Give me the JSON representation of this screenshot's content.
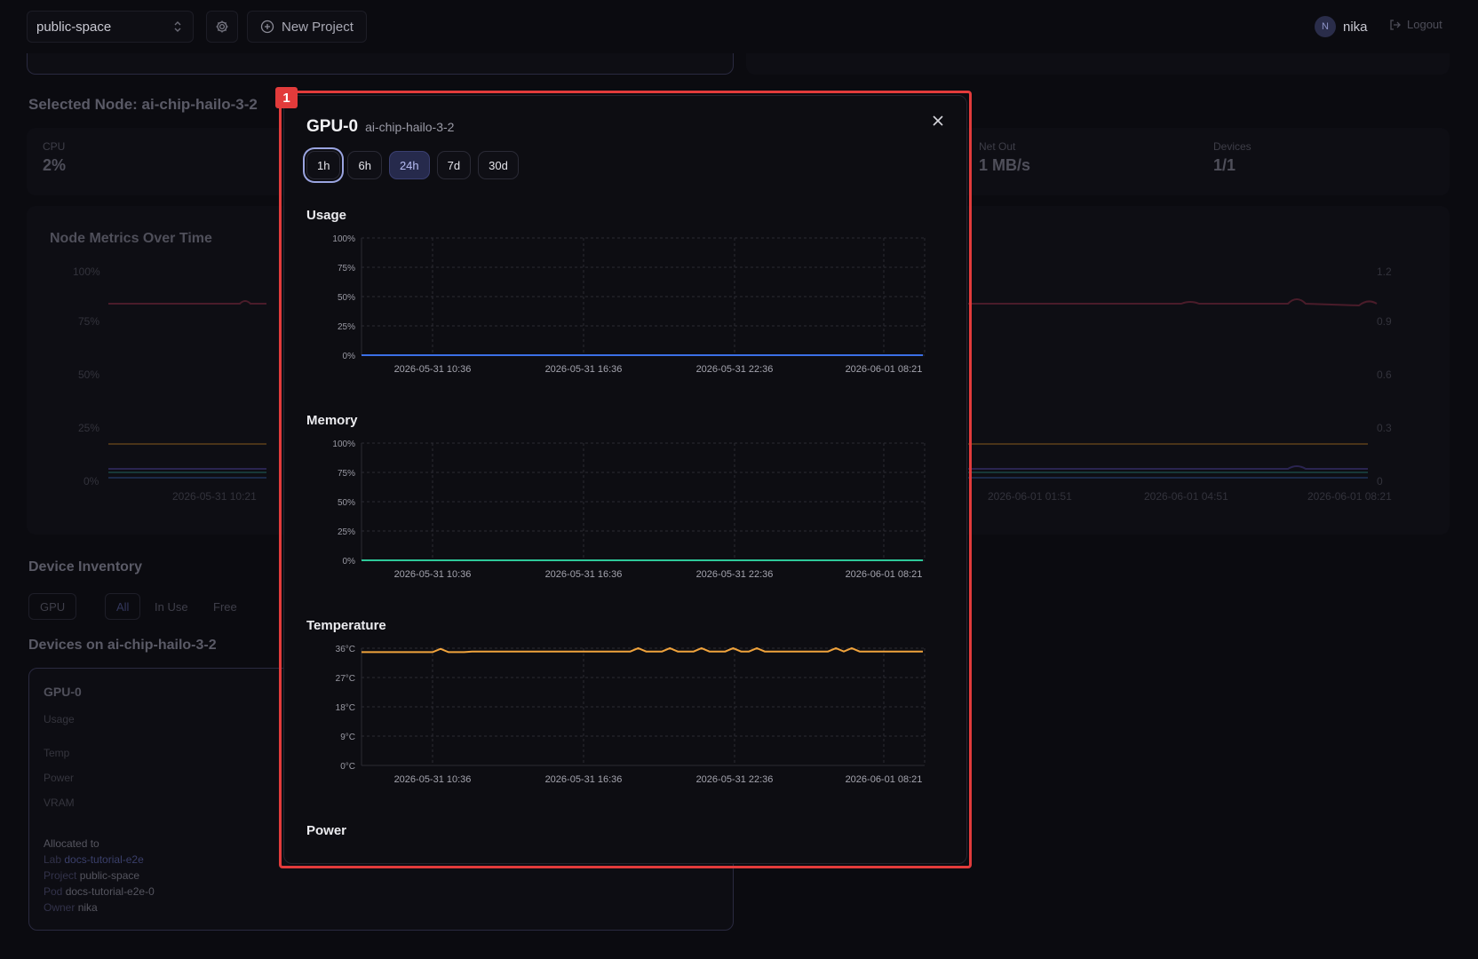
{
  "topbar": {
    "workspace": "public-space",
    "new_project": "New Project",
    "user_initial": "N",
    "user_name": "nika",
    "logout": "Logout"
  },
  "background": {
    "selected_node_title": "Selected Node: ai-chip-hailo-3-2",
    "stats": [
      {
        "label": "CPU",
        "value": "2%"
      },
      {
        "label": "Net Out",
        "value": "1 MB/s"
      },
      {
        "label": "Devices",
        "value": "1/1"
      }
    ],
    "metrics_title": "Node Metrics Over Time",
    "metrics_left_ticks": [
      "100%",
      "75%",
      "50%",
      "25%",
      "0%"
    ],
    "metrics_right_ticks": [
      "1.2",
      "0.9",
      "0.6",
      "0.3",
      "0"
    ],
    "metrics_x_ticks": [
      "2026-05-31 10:21",
      "2026-06-01 01:51",
      "2026-06-01 04:51",
      "2026-06-01 08:21"
    ],
    "inventory_title": "Device Inventory",
    "filters": [
      "GPU",
      "All",
      "In Use",
      "Free"
    ],
    "devices_title": "Devices on ai-chip-hailo-3-2",
    "device_card": {
      "name": "GPU-0",
      "rows": [
        "Usage",
        "Temp",
        "Power",
        "VRAM"
      ],
      "allocated_to": "Allocated to",
      "lab_key": "Lab",
      "lab_val": "docs-tutorial-e2e",
      "project_key": "Project",
      "project_val": "public-space",
      "pod_key": "Pod",
      "pod_val": "docs-tutorial-e2e-0",
      "owner_key": "Owner",
      "owner_val": "nika"
    }
  },
  "modal": {
    "title": "GPU-0",
    "subtitle": "ai-chip-hailo-3-2",
    "ranges": [
      "1h",
      "6h",
      "24h",
      "7d",
      "30d"
    ],
    "active_range": "24h",
    "focused_range": "1h",
    "sections": {
      "usage": "Usage",
      "memory": "Memory",
      "temperature": "Temperature",
      "power": "Power"
    },
    "highlight_badge": "1"
  },
  "colors": {
    "usage_line": "#3b6fe6",
    "memory_line": "#2ec99a",
    "temp_line": "#f0a33c",
    "highlight": "#e23b3b"
  },
  "chart_data": [
    {
      "type": "line",
      "title": "Usage",
      "x_ticks": [
        "2026-05-31 10:36",
        "2026-05-31 16:36",
        "2026-05-31 22:36",
        "2026-06-01 08:21"
      ],
      "y_ticks": [
        "100%",
        "75%",
        "50%",
        "25%",
        "0%"
      ],
      "ylim": [
        0,
        100
      ],
      "values": [
        0,
        0,
        0,
        0,
        0,
        0,
        0,
        0,
        0,
        0,
        0,
        0,
        0,
        0,
        0,
        0,
        0,
        0,
        0,
        0,
        0,
        0,
        0,
        0
      ]
    },
    {
      "type": "line",
      "title": "Memory",
      "x_ticks": [
        "2026-05-31 10:36",
        "2026-05-31 16:36",
        "2026-05-31 22:36",
        "2026-06-01 08:21"
      ],
      "y_ticks": [
        "100%",
        "75%",
        "50%",
        "25%",
        "0%"
      ],
      "ylim": [
        0,
        100
      ],
      "values": [
        0,
        0,
        0,
        0,
        0,
        0,
        0,
        0,
        0,
        0,
        0,
        0,
        0,
        0,
        0,
        0,
        0,
        0,
        0,
        0,
        0,
        0,
        0,
        0
      ]
    },
    {
      "type": "line",
      "title": "Temperature",
      "x_ticks": [
        "2026-05-31 10:36",
        "2026-05-31 16:36",
        "2026-05-31 22:36",
        "2026-06-01 08:21"
      ],
      "y_ticks": [
        "36°C",
        "27°C",
        "18°C",
        "9°C",
        "0°C"
      ],
      "ylim": [
        0,
        36
      ],
      "values": [
        34.8,
        34.8,
        34.8,
        34.8,
        34.8,
        34.8,
        34.8,
        34.8,
        34.8,
        34.8,
        35.8,
        34.8,
        34.8,
        34.8,
        35.0,
        35.0,
        35.0,
        35.0,
        35.0,
        35.0,
        35.0,
        35.0,
        35.0,
        35.0,
        35.0,
        35.0,
        35.0,
        35.0,
        35.0,
        35.0,
        35.0,
        35.0,
        35.0,
        35.0,
        35.0,
        36.0,
        35.0,
        35.0,
        35.0,
        36.0,
        35.0,
        35.0,
        35.0,
        36.0,
        35.0,
        35.0,
        35.0,
        36.0,
        35.0,
        35.0,
        36.0,
        35.0,
        35.0,
        35.0,
        35.0,
        35.0,
        35.0,
        35.0,
        35.0,
        35.0,
        36.0,
        35.0,
        36.0,
        35.0,
        35.0,
        35.0,
        35.0,
        35.0,
        35.0,
        35.0,
        35.0,
        35.0
      ]
    }
  ]
}
